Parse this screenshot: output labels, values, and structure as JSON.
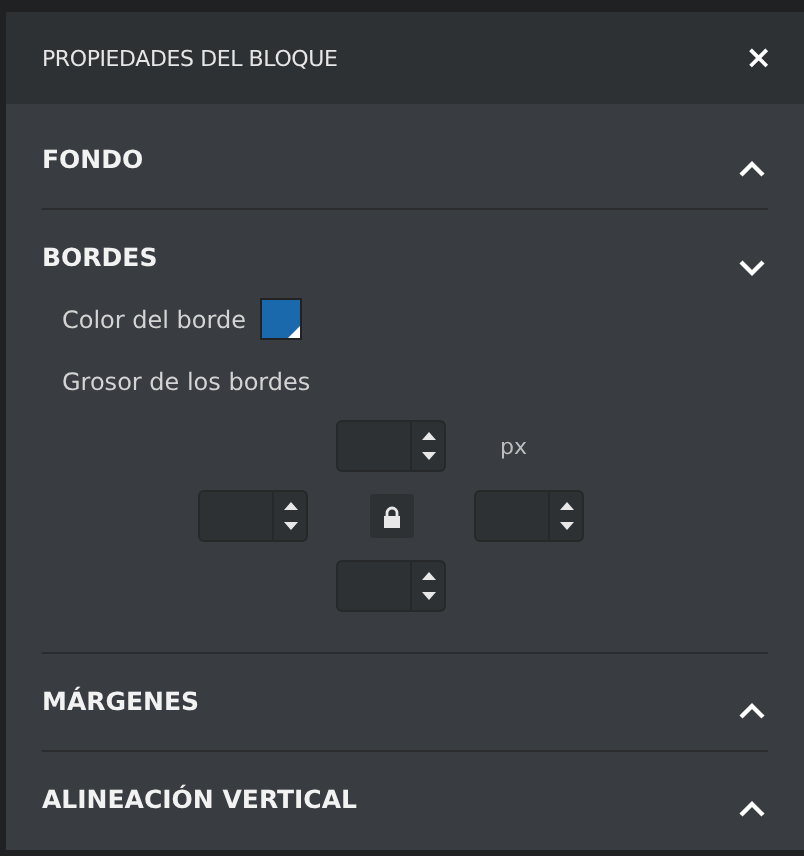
{
  "panel": {
    "title": "PROPIEDADES DEL BLOQUE",
    "close": "×"
  },
  "sections": [
    {
      "title": "FONDO",
      "expanded": false
    },
    {
      "title": "BORDES",
      "expanded": true,
      "color_label": "Color del borde",
      "color": "#1a69ad",
      "width_label": "Grosor de los bordes",
      "unit": "px"
    },
    {
      "title": "MÁRGENES",
      "expanded": false
    },
    {
      "title": "ALINEACIÓN VERTICAL",
      "expanded": false
    }
  ]
}
